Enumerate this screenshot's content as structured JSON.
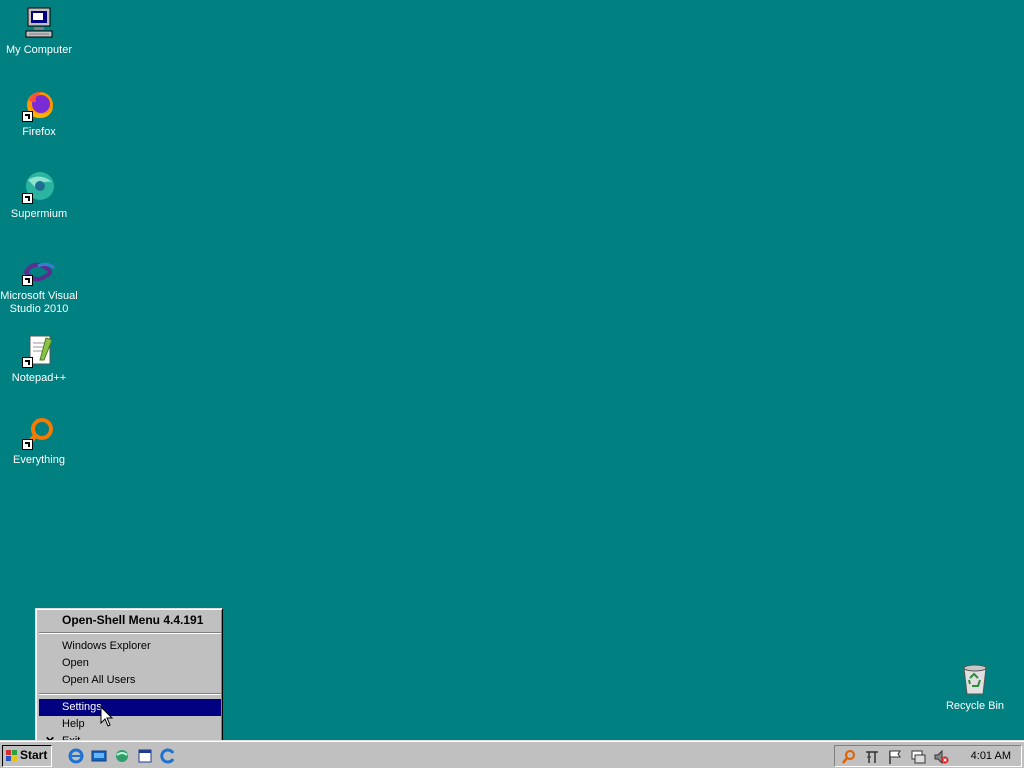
{
  "desktop": {
    "icons": [
      {
        "label": "My Computer"
      },
      {
        "label": "Firefox"
      },
      {
        "label": "Supermium"
      },
      {
        "label": "Microsoft Visual Studio 2010"
      },
      {
        "label": "Notepad++"
      },
      {
        "label": "Everything"
      },
      {
        "label": "Recycle Bin"
      }
    ],
    "background_color": "#008080"
  },
  "context_menu": {
    "title": "Open-Shell Menu 4.4.191",
    "items": [
      {
        "label": "Windows Explorer"
      },
      {
        "label": "Open"
      },
      {
        "label": "Open All Users"
      },
      {
        "label": "Settings",
        "selected": true
      },
      {
        "label": "Help"
      },
      {
        "label": "Exit",
        "icon": "close-icon"
      }
    ],
    "highlight_color": "#000080"
  },
  "taskbar": {
    "start_label": "Start",
    "quick_launch": [
      "internet-explorer-icon",
      "show-desktop-icon",
      "network-icon",
      "window-icon",
      "browser-icon"
    ],
    "tray_icons": [
      "search-icon",
      "network-settings-icon",
      "flag-icon",
      "network-connection-icon",
      "volume-muted-icon"
    ],
    "clock": "4:01 AM"
  }
}
